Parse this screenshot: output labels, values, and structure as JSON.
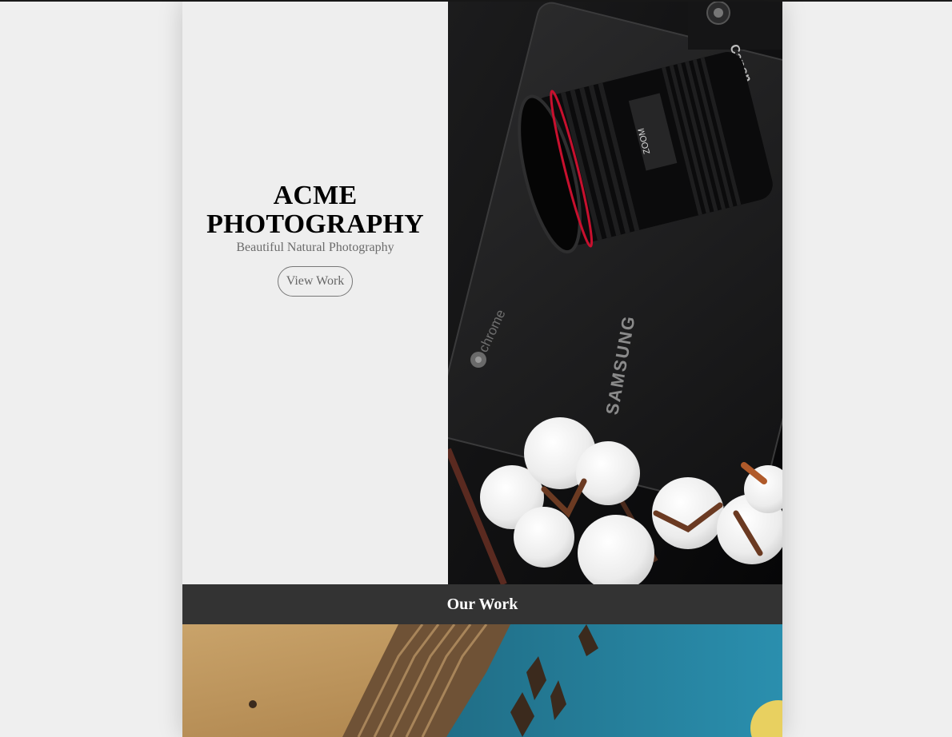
{
  "hero": {
    "title": "ACME PHOTOGRAPHY",
    "tagline": "Beautiful Natural Photography",
    "button_label": "View Work"
  },
  "hero_image": {
    "camera_brand": "Canon",
    "lens_markings": "ZOOM",
    "laptop_brand": "SAMSUNG",
    "laptop_label": "chrome"
  },
  "section": {
    "title": "Our Work"
  },
  "colors": {
    "page_background": "#efefef",
    "panel_background": "#eeeeee",
    "band_background": "#333333",
    "band_text": "#ffffff",
    "tagline_text": "#6b6b6b"
  }
}
